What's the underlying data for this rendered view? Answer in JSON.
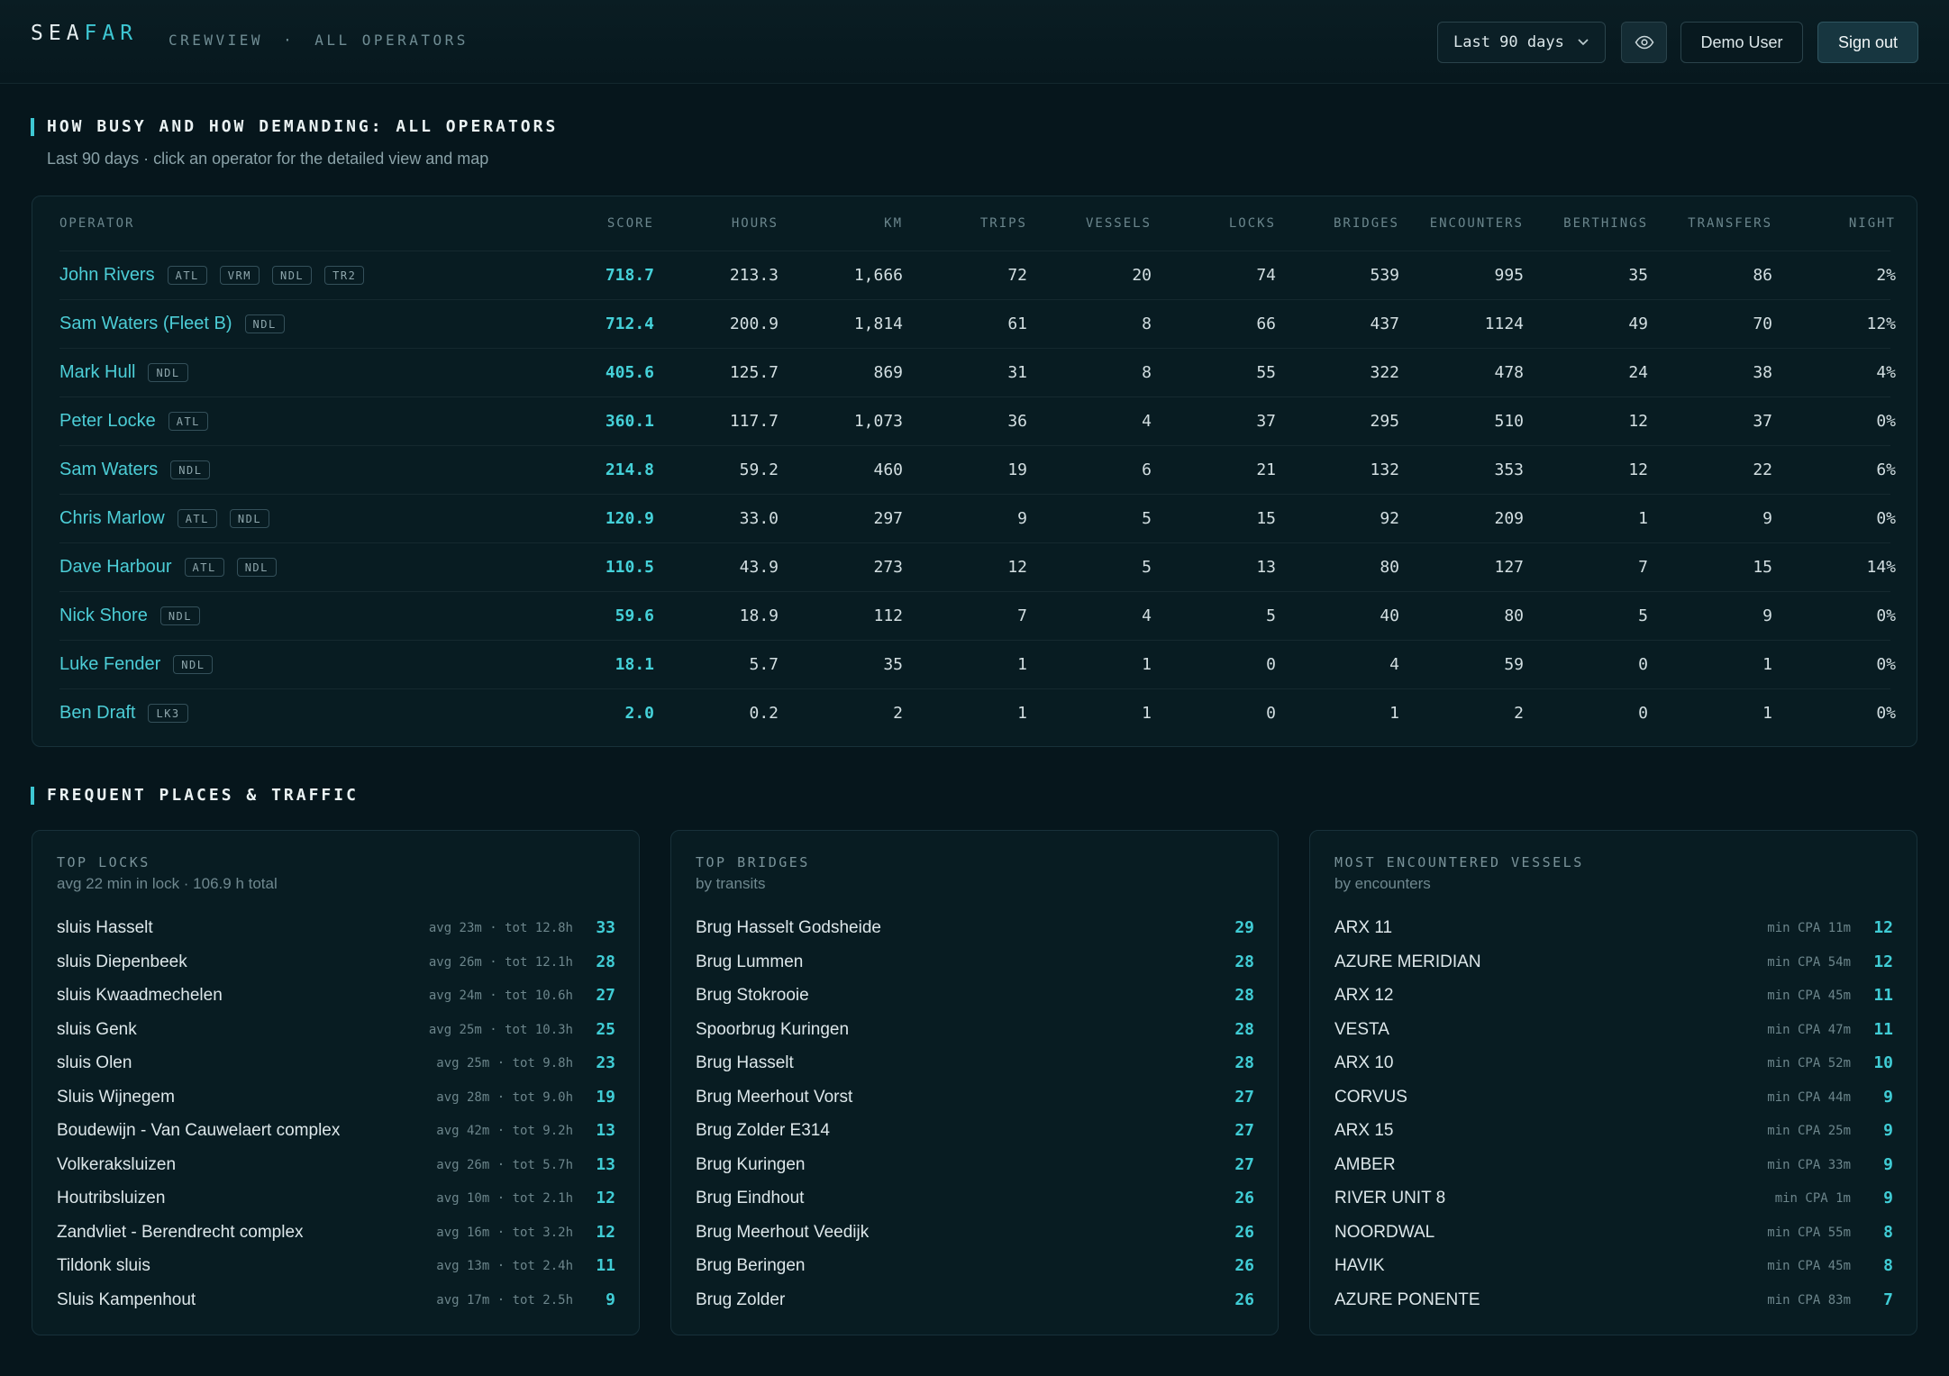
{
  "header": {
    "brand_a": "SEA",
    "brand_b": "FAR",
    "crumb_app": "CREWVIEW",
    "crumb_sep": "·",
    "crumb_page": "ALL OPERATORS",
    "range_label": "Last 90 days",
    "user_label": "Demo User",
    "signout_label": "Sign out",
    "accent_color": "#3ec7d3"
  },
  "operators_section": {
    "title": "HOW BUSY AND HOW DEMANDING: ALL OPERATORS",
    "subtitle": "Last 90 days · click an operator for the detailed view and map",
    "columns": [
      "OPERATOR",
      "SCORE",
      "HOURS",
      "KM",
      "TRIPS",
      "VESSELS",
      "LOCKS",
      "BRIDGES",
      "ENCOUNTERS",
      "BERTHINGS",
      "TRANSFERS",
      "NIGHT"
    ],
    "rows": [
      {
        "name": "John Rivers",
        "tags": [
          "ATL",
          "VRM",
          "NDL",
          "TR2"
        ],
        "score": "718.7",
        "hours": "213.3",
        "km": "1,666",
        "trips": "72",
        "vessels": "20",
        "locks": "74",
        "bridges": "539",
        "encounters": "995",
        "berthings": "35",
        "transfers": "86",
        "night": "2%"
      },
      {
        "name": "Sam Waters (Fleet B)",
        "tags": [
          "NDL"
        ],
        "score": "712.4",
        "hours": "200.9",
        "km": "1,814",
        "trips": "61",
        "vessels": "8",
        "locks": "66",
        "bridges": "437",
        "encounters": "1124",
        "berthings": "49",
        "transfers": "70",
        "night": "12%"
      },
      {
        "name": "Mark Hull",
        "tags": [
          "NDL"
        ],
        "score": "405.6",
        "hours": "125.7",
        "km": "869",
        "trips": "31",
        "vessels": "8",
        "locks": "55",
        "bridges": "322",
        "encounters": "478",
        "berthings": "24",
        "transfers": "38",
        "night": "4%"
      },
      {
        "name": "Peter Locke",
        "tags": [
          "ATL"
        ],
        "score": "360.1",
        "hours": "117.7",
        "km": "1,073",
        "trips": "36",
        "vessels": "4",
        "locks": "37",
        "bridges": "295",
        "encounters": "510",
        "berthings": "12",
        "transfers": "37",
        "night": "0%"
      },
      {
        "name": "Sam Waters",
        "tags": [
          "NDL"
        ],
        "score": "214.8",
        "hours": "59.2",
        "km": "460",
        "trips": "19",
        "vessels": "6",
        "locks": "21",
        "bridges": "132",
        "encounters": "353",
        "berthings": "12",
        "transfers": "22",
        "night": "6%"
      },
      {
        "name": "Chris Marlow",
        "tags": [
          "ATL",
          "NDL"
        ],
        "score": "120.9",
        "hours": "33.0",
        "km": "297",
        "trips": "9",
        "vessels": "5",
        "locks": "15",
        "bridges": "92",
        "encounters": "209",
        "berthings": "1",
        "transfers": "9",
        "night": "0%"
      },
      {
        "name": "Dave Harbour",
        "tags": [
          "ATL",
          "NDL"
        ],
        "score": "110.5",
        "hours": "43.9",
        "km": "273",
        "trips": "12",
        "vessels": "5",
        "locks": "13",
        "bridges": "80",
        "encounters": "127",
        "berthings": "7",
        "transfers": "15",
        "night": "14%"
      },
      {
        "name": "Nick Shore",
        "tags": [
          "NDL"
        ],
        "score": "59.6",
        "hours": "18.9",
        "km": "112",
        "trips": "7",
        "vessels": "4",
        "locks": "5",
        "bridges": "40",
        "encounters": "80",
        "berthings": "5",
        "transfers": "9",
        "night": "0%"
      },
      {
        "name": "Luke Fender",
        "tags": [
          "NDL"
        ],
        "score": "18.1",
        "hours": "5.7",
        "km": "35",
        "trips": "1",
        "vessels": "1",
        "locks": "0",
        "bridges": "4",
        "encounters": "59",
        "berthings": "0",
        "transfers": "1",
        "night": "0%"
      },
      {
        "name": "Ben Draft",
        "tags": [
          "LK3"
        ],
        "score": "2.0",
        "hours": "0.2",
        "km": "2",
        "trips": "1",
        "vessels": "1",
        "locks": "0",
        "bridges": "1",
        "encounters": "2",
        "berthings": "0",
        "transfers": "1",
        "night": "0%"
      }
    ]
  },
  "places_section": {
    "title": "FREQUENT PLACES & TRAFFIC",
    "cards": [
      {
        "title": "TOP LOCKS",
        "subtitle": "avg 22 min in lock · 106.9 h total",
        "items": [
          {
            "name": "sluis Hasselt",
            "meta": "avg 23m · tot 12.8h",
            "count": "33"
          },
          {
            "name": "sluis Diepenbeek",
            "meta": "avg 26m · tot 12.1h",
            "count": "28"
          },
          {
            "name": "sluis Kwaadmechelen",
            "meta": "avg 24m · tot 10.6h",
            "count": "27"
          },
          {
            "name": "sluis Genk",
            "meta": "avg 25m · tot 10.3h",
            "count": "25"
          },
          {
            "name": "sluis Olen",
            "meta": "avg 25m · tot 9.8h",
            "count": "23"
          },
          {
            "name": "Sluis Wijnegem",
            "meta": "avg 28m · tot 9.0h",
            "count": "19"
          },
          {
            "name": "Boudewijn - Van Cauwelaert complex",
            "meta": "avg 42m · tot 9.2h",
            "count": "13"
          },
          {
            "name": "Volkeraksluizen",
            "meta": "avg 26m · tot 5.7h",
            "count": "13"
          },
          {
            "name": "Houtribsluizen",
            "meta": "avg 10m · tot 2.1h",
            "count": "12"
          },
          {
            "name": "Zandvliet - Berendrecht complex",
            "meta": "avg 16m · tot 3.2h",
            "count": "12"
          },
          {
            "name": "Tildonk sluis",
            "meta": "avg 13m · tot 2.4h",
            "count": "11"
          },
          {
            "name": "Sluis Kampenhout",
            "meta": "avg 17m · tot 2.5h",
            "count": "9"
          }
        ]
      },
      {
        "title": "TOP BRIDGES",
        "subtitle": "by transits",
        "items": [
          {
            "name": "Brug Hasselt Godsheide",
            "meta": "",
            "count": "29"
          },
          {
            "name": "Brug Lummen",
            "meta": "",
            "count": "28"
          },
          {
            "name": "Brug Stokrooie",
            "meta": "",
            "count": "28"
          },
          {
            "name": "Spoorbrug Kuringen",
            "meta": "",
            "count": "28"
          },
          {
            "name": "Brug Hasselt",
            "meta": "",
            "count": "28"
          },
          {
            "name": "Brug Meerhout Vorst",
            "meta": "",
            "count": "27"
          },
          {
            "name": "Brug Zolder E314",
            "meta": "",
            "count": "27"
          },
          {
            "name": "Brug Kuringen",
            "meta": "",
            "count": "27"
          },
          {
            "name": "Brug Eindhout",
            "meta": "",
            "count": "26"
          },
          {
            "name": "Brug Meerhout Veedijk",
            "meta": "",
            "count": "26"
          },
          {
            "name": "Brug Beringen",
            "meta": "",
            "count": "26"
          },
          {
            "name": "Brug Zolder",
            "meta": "",
            "count": "26"
          }
        ]
      },
      {
        "title": "MOST ENCOUNTERED VESSELS",
        "subtitle": "by encounters",
        "items": [
          {
            "name": "ARX 11",
            "meta": "min CPA 11m",
            "count": "12"
          },
          {
            "name": "AZURE MERIDIAN",
            "meta": "min CPA 54m",
            "count": "12"
          },
          {
            "name": "ARX 12",
            "meta": "min CPA 45m",
            "count": "11"
          },
          {
            "name": "VESTA",
            "meta": "min CPA 47m",
            "count": "11"
          },
          {
            "name": "ARX 10",
            "meta": "min CPA 52m",
            "count": "10"
          },
          {
            "name": "CORVUS",
            "meta": "min CPA 44m",
            "count": "9"
          },
          {
            "name": "ARX 15",
            "meta": "min CPA 25m",
            "count": "9"
          },
          {
            "name": "AMBER",
            "meta": "min CPA 33m",
            "count": "9"
          },
          {
            "name": "RIVER UNIT 8",
            "meta": "min CPA 1m",
            "count": "9"
          },
          {
            "name": "NOORDWAL",
            "meta": "min CPA 55m",
            "count": "8"
          },
          {
            "name": "HAVIK",
            "meta": "min CPA 45m",
            "count": "8"
          },
          {
            "name": "AZURE PONENTE",
            "meta": "min CPA 83m",
            "count": "7"
          }
        ]
      }
    ]
  }
}
